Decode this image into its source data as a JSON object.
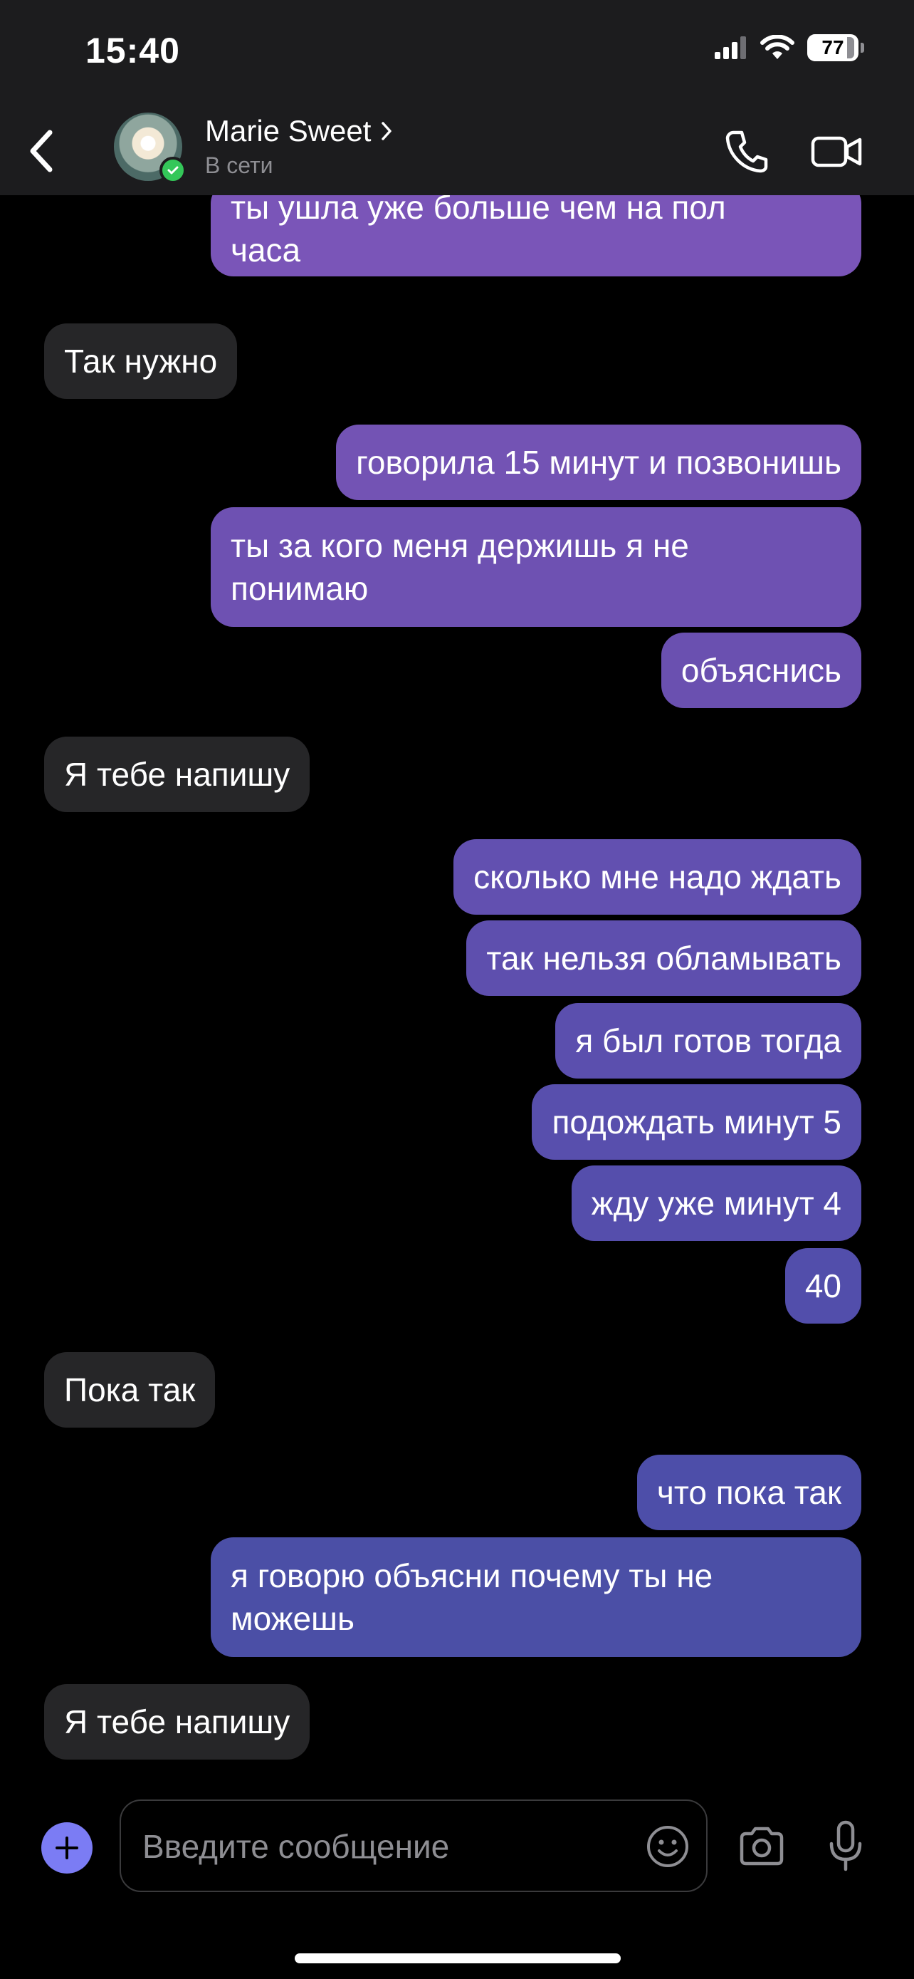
{
  "status_bar": {
    "time": "15:40",
    "battery": "77"
  },
  "header": {
    "contact_name": "Marie Sweet",
    "status": "В сети"
  },
  "messages": [
    {
      "dir": "out",
      "text": "ты ушла уже больше чем на пол\nчаса"
    },
    {
      "dir": "in",
      "text": "Так нужно"
    },
    {
      "dir": "out",
      "text": "говорила 15 минут и позвонишь"
    },
    {
      "dir": "out",
      "text": "ты за кого меня держишь я не\nпонимаю"
    },
    {
      "dir": "out",
      "text": "объяснись"
    },
    {
      "dir": "in",
      "text": "Я тебе напишу"
    },
    {
      "dir": "out",
      "text": "сколько мне надо ждать"
    },
    {
      "dir": "out",
      "text": "так нельзя обламывать"
    },
    {
      "dir": "out",
      "text": "я был готов тогда"
    },
    {
      "dir": "out",
      "text": "подождать минут 5"
    },
    {
      "dir": "out",
      "text": "жду уже минут 4"
    },
    {
      "dir": "out",
      "text": "40"
    },
    {
      "dir": "in",
      "text": "Пока так"
    },
    {
      "dir": "out",
      "text": "что пока так"
    },
    {
      "dir": "out",
      "text": "я говорю объясни почему ты не\nможешь"
    },
    {
      "dir": "in",
      "text": "Я тебе напишу"
    }
  ],
  "composer": {
    "placeholder": "Введите сообщение"
  },
  "colors": {
    "outgoing_top": "#7a55b8",
    "outgoing_bottom": "#4b4fa6",
    "incoming": "#262628",
    "accent": "#7b7cf4",
    "online": "#34c759"
  },
  "icons": [
    "back-chevron-icon",
    "phone-icon",
    "video-icon",
    "plus-icon",
    "emoji-icon",
    "camera-icon",
    "mic-icon"
  ]
}
